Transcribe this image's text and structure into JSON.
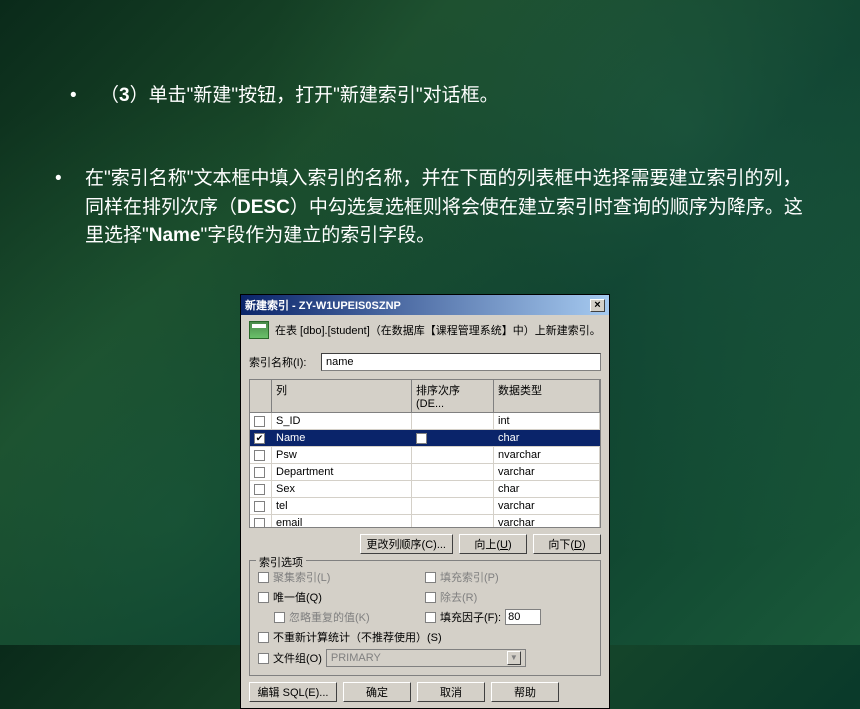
{
  "slide": {
    "bullet_3": "（3）单击\"新建\"按钮，打开\"新建索引\"对话框。",
    "para_2": "在\"索引名称\"文本框中填入索引的名称，并在下面的列表框中选择需要建立索引的列，同样在排列次序（DESC）中勾选复选框则将会使在建立索引时查询的顺序为降序。这里选择\"Name\"字段作为建立的索引字段。"
  },
  "dialog": {
    "title": "新建索引 - ZY-W1UPEIS0SZNP",
    "header_text": "在表 [dbo].[student]（在数据库【课程管理系统】中）上新建索引。",
    "index_name_label": "索引名称(I):",
    "index_name_value": "name",
    "columns": {
      "col_name": "列",
      "col_sort": "排序次序 (DE...",
      "col_type": "数据类型"
    },
    "rows": [
      {
        "checked": false,
        "name": "S_ID",
        "sort": "",
        "type": "int"
      },
      {
        "checked": true,
        "name": "Name",
        "sort": "",
        "type": "char"
      },
      {
        "checked": false,
        "name": "Psw",
        "sort": "",
        "type": "nvarchar"
      },
      {
        "checked": false,
        "name": "Department",
        "sort": "",
        "type": "varchar"
      },
      {
        "checked": false,
        "name": "Sex",
        "sort": "",
        "type": "char"
      },
      {
        "checked": false,
        "name": "tel",
        "sort": "",
        "type": "varchar"
      },
      {
        "checked": false,
        "name": "email",
        "sort": "",
        "type": "varchar"
      }
    ],
    "buttons": {
      "change_order": "更改列顺序(C)...",
      "move_up": "向上(U)",
      "move_down": "向下(D)",
      "edit_sql": "编辑 SQL(E)...",
      "ok": "确定",
      "cancel": "取消",
      "help": "帮助"
    },
    "options": {
      "group_title": "索引选项",
      "clustered": "聚集索引(L)",
      "pad": "填充索引(P)",
      "unique": "唯一值(Q)",
      "drop": "除去(R)",
      "ignore_dup": "忽略重复的值(K)",
      "fill_factor": "填充因子(F):",
      "fill_factor_value": "80",
      "no_recompute": "不重新计算统计（不推荐使用）(S)",
      "filegroup_label": "文件组(O)",
      "filegroup_value": "PRIMARY"
    }
  }
}
